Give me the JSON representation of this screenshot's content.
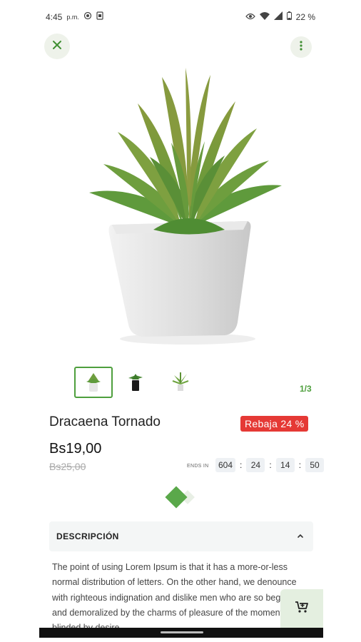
{
  "status_bar": {
    "time": "4:45",
    "ampm": "p.m.",
    "battery": "22 %"
  },
  "product": {
    "name": "Dracaena Tornado",
    "sale_badge": "Rebaja 24 %",
    "price": "Bs19,00",
    "old_price": "Bs25,00",
    "image_counter": "1/3"
  },
  "countdown": {
    "label": "ENDS IN",
    "days": "604",
    "hours": "24",
    "minutes": "14",
    "seconds": "50"
  },
  "description": {
    "header": "DESCRIPCIÓN",
    "text": "The point of using Lorem Ipsum is that it has a more-or-less normal distribution of letters. On the other hand, we denounce with righteous indignation and dislike men who are so beguiled and demoralized by the charms of pleasure of the moment, so blinded by desire"
  },
  "colors": {
    "accent": "#4e9f3d",
    "sale": "#e53935"
  }
}
